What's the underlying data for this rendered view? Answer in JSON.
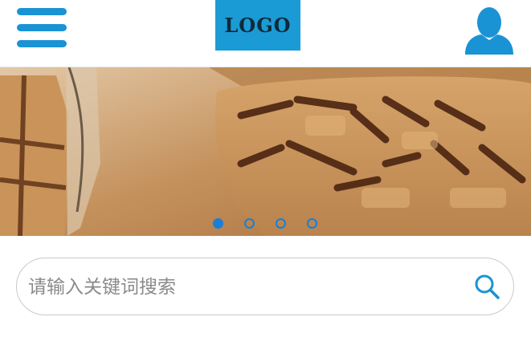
{
  "header": {
    "logo_text": "LOGO",
    "menu_icon": "hamburger-menu-icon",
    "user_icon": "user-avatar-icon",
    "accent_color": "#1a93d5"
  },
  "banner": {
    "image": "waffle-photo",
    "slide_count": 4,
    "active_slide": 1
  },
  "search": {
    "placeholder": "请输入关键词搜索",
    "value": "",
    "icon": "search-icon"
  }
}
